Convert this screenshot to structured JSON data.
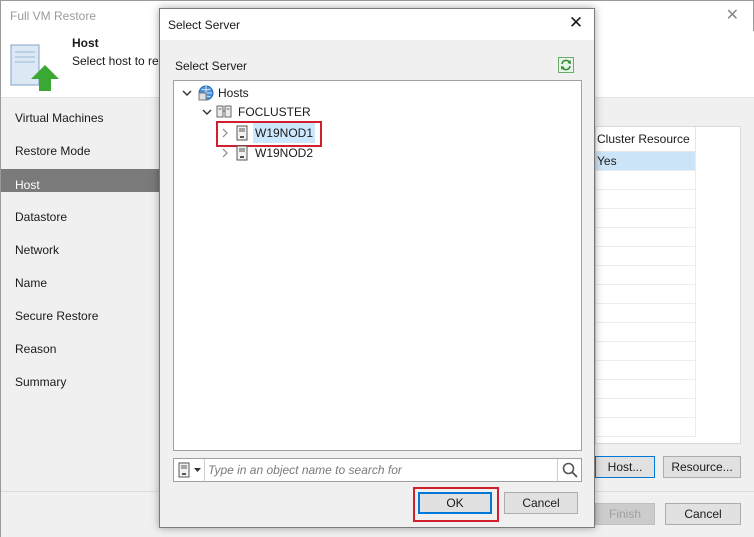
{
  "wizard": {
    "title": "Full VM Restore",
    "step_title": "Host",
    "step_desc": "Select host to res",
    "steps": [
      {
        "label": "Virtual Machines"
      },
      {
        "label": "Restore Mode"
      },
      {
        "label": "Host"
      },
      {
        "label": "Datastore"
      },
      {
        "label": "Network"
      },
      {
        "label": "Name"
      },
      {
        "label": "Secure Restore"
      },
      {
        "label": "Reason"
      },
      {
        "label": "Summary"
      }
    ],
    "table": {
      "header": "Cluster Resource",
      "rows": [
        "Yes"
      ]
    },
    "host_button": "Host...",
    "resource_button": "Resource...",
    "finish_button": "Finish",
    "cancel_button": "Cancel"
  },
  "dialog": {
    "title": "Select Server",
    "label": "Select Server",
    "tree": {
      "root": "Hosts",
      "cluster": "FOCLUSTER",
      "nodes": [
        "W19NOD1",
        "W19NOD2"
      ]
    },
    "search": {
      "placeholder": "Type in an object name to search for",
      "value": ""
    },
    "ok_button": "OK",
    "cancel_button": "Cancel"
  },
  "colors": {
    "highlight_red": "#d11f2f",
    "selection_blue": "#cce8ff",
    "focus_blue": "#0078d7",
    "active_step": "#7a7a7a"
  }
}
